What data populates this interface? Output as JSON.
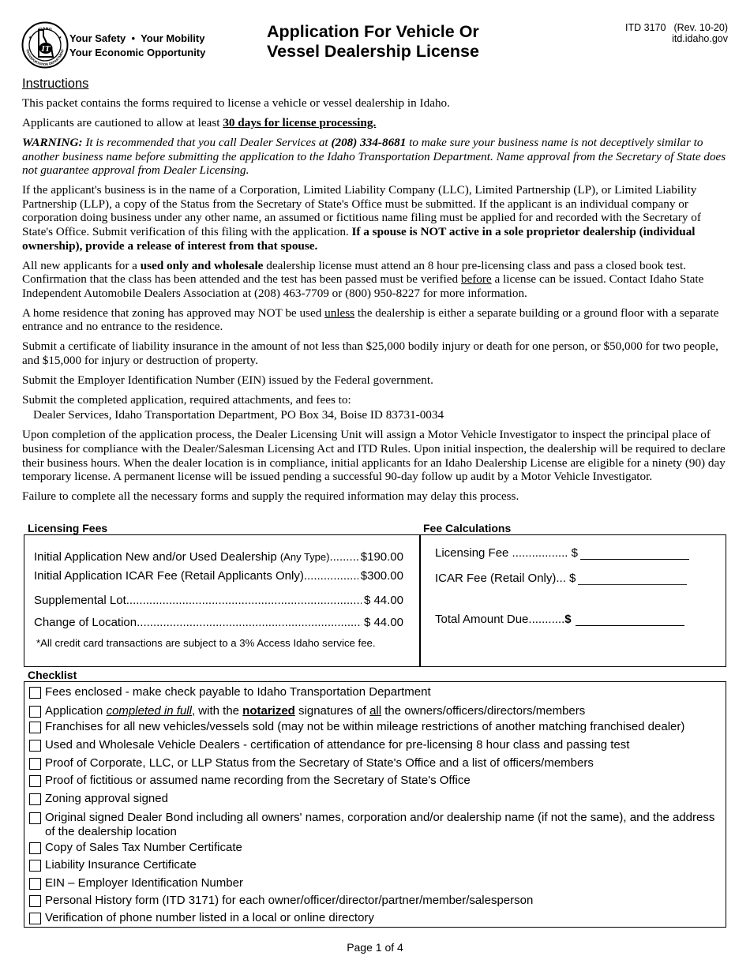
{
  "header": {
    "logo_alt": "Idaho Transportation Department",
    "tagline_line1_a": "Your Safety",
    "tagline_bullet": "•",
    "tagline_line1_b": "Your Mobility",
    "tagline_line2": "Your Economic Opportunity",
    "title_line1": "Application For Vehicle Or",
    "title_line2": "Vessel Dealership License",
    "form_number": "ITD 3170",
    "revision": "(Rev. 10-20)",
    "website": "itd.idaho.gov"
  },
  "instructions": {
    "heading": "Instructions",
    "p1": "This packet contains the forms required to license a vehicle or vessel dealership in Idaho.",
    "p2_a": "Applicants are cautioned to allow at least ",
    "p2_b": "30 days for license processing.",
    "p3_label": "WARNING:",
    "p3_a": "  It is recommended that you call Dealer Services at ",
    "p3_phone": "(208) 334-8681",
    "p3_b": " to make sure your business name is not deceptively similar to another business name before submitting the application to the Idaho Transportation Department. Name approval from the Secretary of State does not guarantee approval from Dealer Licensing.",
    "p4_a": "If the applicant's business is in the name of a Corporation, Limited Liability Company (LLC), Limited Partnership (LP), or Limited Liability Partnership (LLP), a copy of the Status from the Secretary of State's Office must be submitted.  If the applicant is an individual company or corporation doing business under any other name, an assumed or fictitious name filing must be applied for and recorded with the Secretary of State's Office.  Submit verification of this filing with the application.  ",
    "p4_b": "If a spouse is NOT active in a sole proprietor dealership (individual ownership), provide a release of interest from that spouse.",
    "p5_a": "All new applicants for a ",
    "p5_b": "used only and wholesale",
    "p5_c": " dealership license must attend an 8 hour pre-licensing class and pass a closed book test.  Confirmation that the class has been attended and the test has been passed must be verified ",
    "p5_d": "before",
    "p5_e": " a license can be issued.  Contact Idaho State Independent Automobile Dealers Association at (208) 463-7709 or (800) 950-8227 for more information.",
    "p6_a": "A home residence that zoning has approved may NOT be used ",
    "p6_b": "unless",
    "p6_c": " the dealership is either a separate building or a ground floor with a separate entrance and no entrance to the residence.",
    "p7": "Submit a certificate of liability insurance in the amount of not less than $25,000 bodily injury or death for one person, or $50,000 for two people, and $15,000 for injury or destruction of property.",
    "p8": "Submit the Employer Identification Number (EIN) issued by the Federal government.",
    "p9": "Submit the completed application, required attachments, and fees to:",
    "address": "Dealer Services, Idaho Transportation Department, PO Box 34, Boise ID  83731-0034",
    "p10": "Upon completion of the application process, the Dealer Licensing Unit will assign a Motor Vehicle Investigator to inspect the principal place of business for compliance with the Dealer/Salesman Licensing Act and ITD Rules.  Upon initial inspection, the dealership will be required to declare their business hours.  When the dealer location is in compliance, initial applicants for an Idaho Dealership License are eligible for a ninety (90) day temporary license.  A permanent license will be issued pending a successful 90-day follow up audit by a Motor Vehicle Investigator.",
    "p11": "Failure to complete all the necessary forms and supply the required information may delay this process."
  },
  "licensing_fees": {
    "heading": "Licensing Fees",
    "items": [
      {
        "label": "Initial Application New and/or Used Dealership ",
        "label_small": "(Any Type)",
        "amount": "$190.00"
      },
      {
        "label": "Initial Application ICAR Fee (Retail Applicants Only)",
        "label_small": "",
        "amount": "$300.00"
      },
      {
        "label": "Supplemental Lot",
        "label_small": "",
        "amount": "$  44.00"
      },
      {
        "label": "Change of Location ",
        "label_small": "",
        "amount": "$  44.00"
      }
    ],
    "note": "*All credit card transactions are subject to a 3% Access Idaho service fee."
  },
  "fee_calculations": {
    "heading": "Fee Calculations",
    "licensing_fee_label": "Licensing Fee .................",
    "licensing_fee_currency": "$",
    "licensing_fee_value": "",
    "icar_fee_label": "ICAR Fee (Retail Only)...",
    "icar_fee_currency": "$",
    "icar_fee_value": "",
    "total_label": "Total Amount Due...........",
    "total_currency": "$",
    "total_value": ""
  },
  "checklist": {
    "heading": "Checklist",
    "items": [
      {
        "text": "Fees enclosed - make check payable to Idaho Transportation Department",
        "checked": false
      },
      {
        "text_a": "Application ",
        "text_b": "completed in full",
        "text_c": ", with the ",
        "text_d": "notarized",
        "text_e": " signatures of ",
        "text_f": "all",
        "text_g": " the owners/officers/directors/members",
        "checked": false
      },
      {
        "text": "Franchises for all new vehicles/vessels sold (may not be within mileage restrictions of another matching franchised dealer)",
        "checked": false
      },
      {
        "text": "Used and Wholesale Vehicle Dealers - certification of attendance for pre-licensing 8 hour class and passing test",
        "checked": false
      },
      {
        "text": "Proof of Corporate, LLC, or LLP Status from the Secretary of State's Office and a list of officers/members",
        "checked": false
      },
      {
        "text": "Proof of fictitious or assumed name recording from the Secretary of State's Office",
        "checked": false
      },
      {
        "text": "Zoning approval signed",
        "checked": false
      },
      {
        "text": "Original signed Dealer Bond including all owners' names, corporation and/or dealership name (if not the same), and the address of the dealership location",
        "checked": false
      },
      {
        "text": "Copy of Sales Tax Number Certificate",
        "checked": false
      },
      {
        "text": "Liability Insurance Certificate",
        "checked": false
      },
      {
        "text": "EIN – Employer Identification Number",
        "checked": false
      },
      {
        "text": "Personal History form (ITD 3171) for each owner/officer/director/partner/member/salesperson",
        "checked": false
      },
      {
        "text": "Verification of phone number listed in a local or online directory",
        "checked": false
      }
    ]
  },
  "footer": {
    "page_label": "Page 1 of 4"
  }
}
